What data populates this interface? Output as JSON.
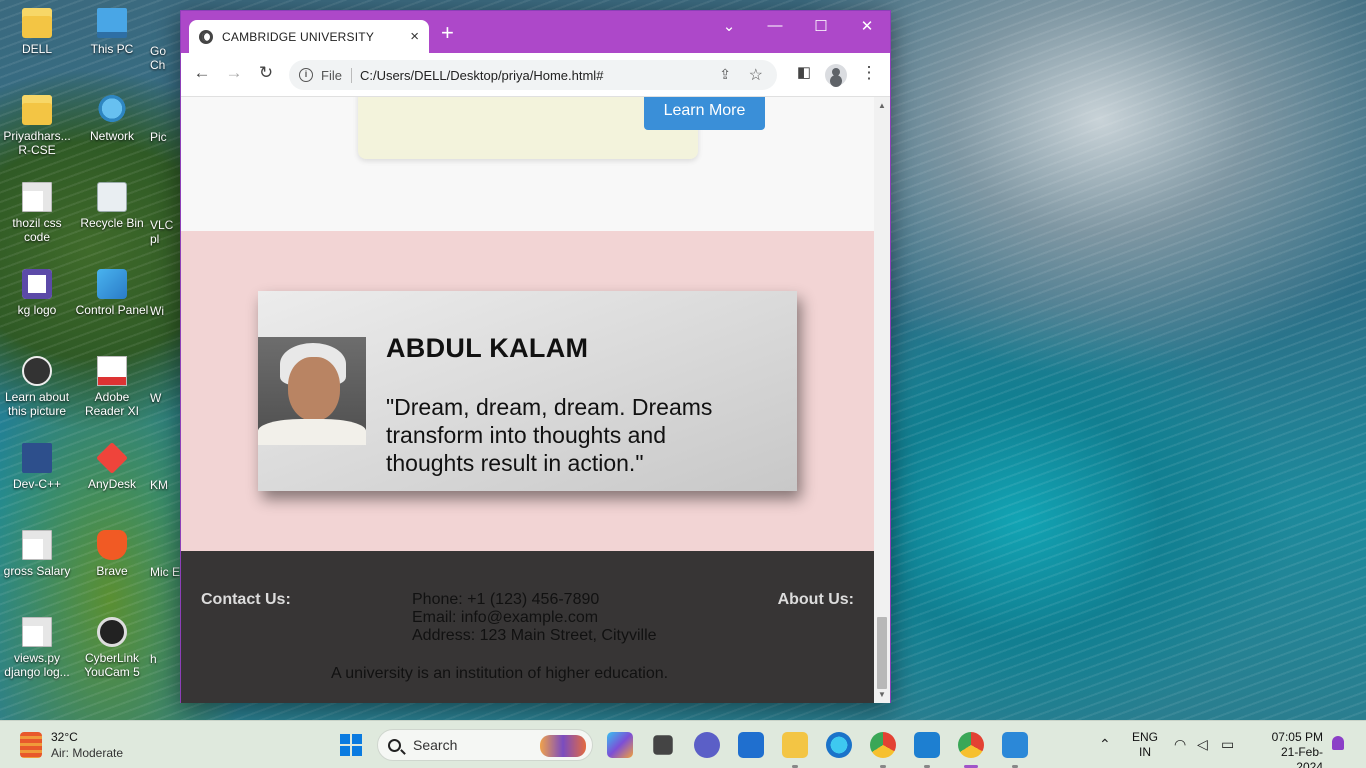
{
  "desktop": {
    "icons": [
      {
        "label": "DELL",
        "icon": "folder-icon"
      },
      {
        "label": "This PC",
        "icon": "computer-icon"
      },
      {
        "label": "Priyadhars... R-CSE",
        "icon": "folder-zip-icon"
      },
      {
        "label": "Network",
        "icon": "network-icon"
      },
      {
        "label": "thozil css code",
        "icon": "file-icon"
      },
      {
        "label": "Recycle Bin",
        "icon": "recycle-bin-icon"
      },
      {
        "label": "kg logo",
        "icon": "image-icon"
      },
      {
        "label": "Control Panel",
        "icon": "control-panel-icon"
      },
      {
        "label": "Learn about this picture",
        "icon": "learn-icon"
      },
      {
        "label": "Adobe Reader XI",
        "icon": "adobe-icon"
      },
      {
        "label": "Dev-C++",
        "icon": "devcpp-icon"
      },
      {
        "label": "AnyDesk",
        "icon": "anydesk-icon"
      },
      {
        "label": "gross Salary",
        "icon": "file-icon"
      },
      {
        "label": "Brave",
        "icon": "brave-icon"
      },
      {
        "label": "views.py django log...",
        "icon": "file-icon"
      },
      {
        "label": "CyberLink YouCam 5",
        "icon": "cyberlink-icon"
      }
    ],
    "partial_labels": [
      "Go Ch",
      "Pic",
      "VLC pl",
      "Wi",
      "W",
      "KM",
      "Mic E",
      "h"
    ]
  },
  "browser": {
    "tab_title": "CAMBRIDGE UNIVERSITY",
    "tab_close": "×",
    "new_tab": "+",
    "scheme": "File",
    "url": "C:/Users/DELL/Desktop/priya/Home.html#",
    "accent": "#ad48c9"
  },
  "page": {
    "learn_more": "Learn More",
    "quote": {
      "name": "ABDUL KALAM",
      "text": "\"Dream, dream, dream. Dreams transform into thoughts and thoughts result in action.\""
    },
    "footer": {
      "contact_title": "Contact Us:",
      "phone": "Phone: +1 (123) 456-7890",
      "email": "Email: info@example.com",
      "address": "Address: 123 Main Street, Cityville",
      "about_title": "About Us:",
      "description": "A university is an institution of higher education."
    }
  },
  "taskbar": {
    "temperature": "32°C",
    "air": "Air: Moderate",
    "search_placeholder": "Search",
    "lang_top": "ENG",
    "lang_bottom": "IN",
    "time": "07:05 PM",
    "date": "21-Feb-2024"
  }
}
